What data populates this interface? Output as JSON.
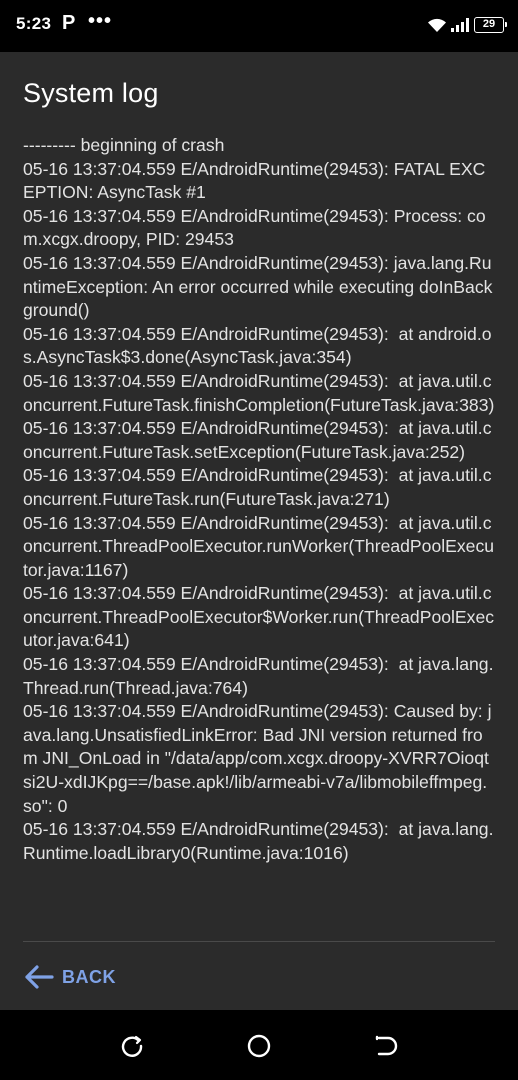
{
  "status_bar": {
    "time": "5:23",
    "app_icon": "P",
    "more_dots": "•••",
    "battery_level": "29",
    "icons": [
      "wifi-icon",
      "signal-icon",
      "battery-icon"
    ]
  },
  "header": {
    "title": "System log"
  },
  "log": {
    "text": "--------- beginning of crash\n05-16 13:37:04.559 E/AndroidRuntime(29453): FATAL EXCEPTION: AsyncTask #1\n05-16 13:37:04.559 E/AndroidRuntime(29453): Process: com.xcgx.droopy, PID: 29453\n05-16 13:37:04.559 E/AndroidRuntime(29453): java.lang.RuntimeException: An error occurred while executing doInBackground()\n05-16 13:37:04.559 E/AndroidRuntime(29453):  at android.os.AsyncTask$3.done(AsyncTask.java:354)\n05-16 13:37:04.559 E/AndroidRuntime(29453):  at java.util.concurrent.FutureTask.finishCompletion(FutureTask.java:383)\n05-16 13:37:04.559 E/AndroidRuntime(29453):  at java.util.concurrent.FutureTask.setException(FutureTask.java:252)\n05-16 13:37:04.559 E/AndroidRuntime(29453):  at java.util.concurrent.FutureTask.run(FutureTask.java:271)\n05-16 13:37:04.559 E/AndroidRuntime(29453):  at java.util.concurrent.ThreadPoolExecutor.runWorker(ThreadPoolExecutor.java:1167)\n05-16 13:37:04.559 E/AndroidRuntime(29453):  at java.util.concurrent.ThreadPoolExecutor$Worker.run(ThreadPoolExecutor.java:641)\n05-16 13:37:04.559 E/AndroidRuntime(29453):  at java.lang.Thread.run(Thread.java:764)\n05-16 13:37:04.559 E/AndroidRuntime(29453): Caused by: java.lang.UnsatisfiedLinkError: Bad JNI version returned from JNI_OnLoad in \"/data/app/com.xcgx.droopy-XVRR7Oioqtsi2U-xdIJKpg==/base.apk!/lib/armeabi-v7a/libmobileffmpeg.so\": 0\n05-16 13:37:04.559 E/AndroidRuntime(29453):  at java.lang.Runtime.loadLibrary0(Runtime.java:1016)"
  },
  "footer": {
    "back_label": "BACK",
    "back_icon": "arrow-left-icon"
  },
  "nav_bar": {
    "icons": [
      "recents-icon",
      "home-icon",
      "back-icon"
    ]
  },
  "colors": {
    "background": "#2b2b2b",
    "status_bar": "#000000",
    "accent": "#7fa2e6",
    "text": "#e3e3e3"
  }
}
